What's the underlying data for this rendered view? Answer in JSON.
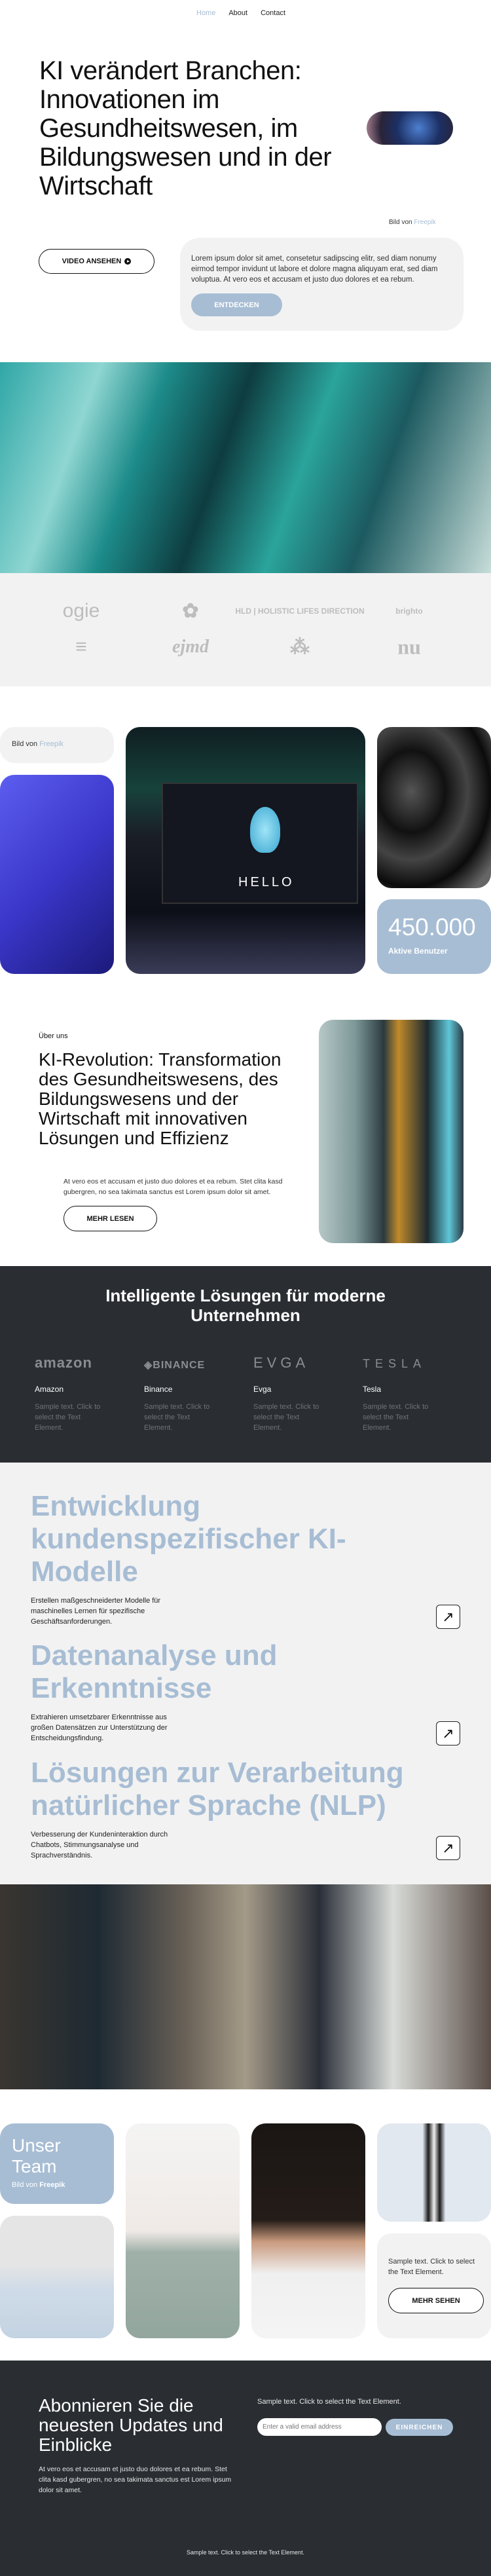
{
  "nav": {
    "items": [
      {
        "label": "Home",
        "active": true
      },
      {
        "label": "About"
      },
      {
        "label": "Contact"
      }
    ]
  },
  "hero": {
    "title": "KI verändert Branchen: Innovationen im Gesundheitswesen, im Bildungswesen und in der Wirtschaft",
    "credit_prefix": "Bild von",
    "credit_link": "Freepik",
    "video_button": "VIDEO ANSEHEN",
    "text": "Lorem ipsum dolor sit amet, consetetur sadipscing elitr, sed diam nonumy eirmod tempor invidunt ut labore et dolore magna aliquyam erat, sed diam voluptua. At vero eos et accusam et justo duo dolores et ea rebum.",
    "discover_button": "ENTDECKEN"
  },
  "logos": [
    "ogie",
    "✿",
    "HLD | HOLISTIC LIFES DIRECTION",
    "brighto",
    "≡",
    "ejmd",
    "⁂",
    "nu"
  ],
  "gallery": {
    "credit_prefix": "Bild von",
    "credit_link": "Freepik",
    "screen_text": "HELLO",
    "stat_value": "450.000",
    "stat_label": "Aktive Benutzer"
  },
  "about": {
    "eyebrow": "Über uns",
    "title": "KI-Revolution: Transformation des Gesundheitswesens, des Bildungswesens und der Wirtschaft mit innovativen Lösungen und Effizienz",
    "text": "At vero eos et accusam et justo duo dolores et ea rebum. Stet clita kasd gubergren, no sea takimata sanctus est Lorem ipsum dolor sit amet.",
    "button": "MEHR LESEN"
  },
  "partners": {
    "title": "Intelligente Lösungen für moderne Unternehmen",
    "items": [
      {
        "logo": "amazon",
        "name": "Amazon",
        "text": "Sample text. Click to select the Text Element."
      },
      {
        "logo": "◈BINANCE",
        "name": "Binance",
        "text": "Sample text. Click to select the Text Element."
      },
      {
        "logo": "EVGA",
        "name": "Evga",
        "text": "Sample text. Click to select the Text Element."
      },
      {
        "logo": "TESLA",
        "name": "Tesla",
        "text": "Sample text. Click to select the Text Element."
      }
    ]
  },
  "services": [
    {
      "title": "Entwicklung kundenspezifischer KI-Modelle",
      "text": "Erstellen maßgeschneiderter Modelle für maschinelles Lernen für spezifische Geschäftsanforderungen."
    },
    {
      "title": "Datenanalyse und Erkenntnisse",
      "text": "Extrahieren umsetzbarer Erkenntnisse aus großen Datensätzen zur Unterstützung der Entscheidungsfindung."
    },
    {
      "title": "Lösungen zur Verarbeitung natürlicher Sprache (NLP)",
      "text": "Verbesserung der Kundeninteraktion durch Chatbots, Stimmungsanalyse und Sprachverständnis."
    }
  ],
  "team": {
    "title": "Unser Team",
    "credit_prefix": "Bild von",
    "credit_link": "Freepik",
    "text": "Sample text. Click to select the Text Element.",
    "button": "MEHR SEHEN"
  },
  "subscribe": {
    "title": "Abonnieren Sie die neuesten Updates und Einblicke",
    "text": "At vero eos et accusam et justo duo dolores et ea rebum. Stet clita kasd gubergren, no sea takimata sanctus est Lorem ipsum dolor sit amet.",
    "side_text": "Sample text. Click to select the Text Element.",
    "email_placeholder": "Enter a valid email address",
    "button": "EINREICHEN"
  },
  "footer": {
    "text": "Sample text. Click to select the Text Element."
  },
  "colors": {
    "accent": "#a7bdd4",
    "dark": "#2a2e33",
    "light": "#f2f2f2"
  }
}
